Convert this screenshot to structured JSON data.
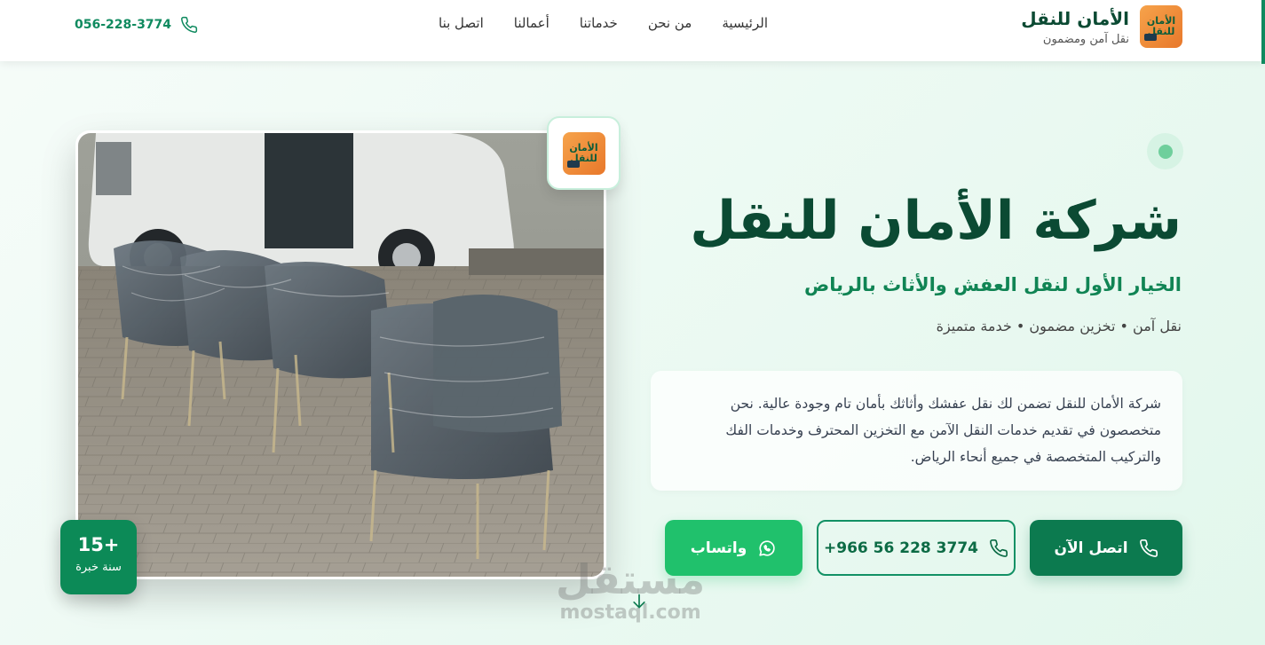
{
  "brand": {
    "name": "الأمان للنقل",
    "tagline": "نقل آمن ومضمون",
    "logo_text_line1": "الأمان",
    "logo_text_line2": "للنقل"
  },
  "nav": {
    "items": [
      "الرئيسية",
      "من نحن",
      "خدماتنا",
      "أعمالنا",
      "اتصل بنا"
    ]
  },
  "header_phone": "056-228-3774",
  "hero": {
    "title": "شركة الأمان للنقل",
    "subtitle": "الخيار الأول لنقل العفش والأثاث بالرياض",
    "features": "نقل آمن • تخزين مضمون • خدمة متميزة",
    "description": "شركة الأمان للنقل تضمن لك نقل عفشك وأثاثك بأمان تام وجودة عالية. نحن متخصصون في تقديم خدمات النقل الآمن مع التخزين المحترف وخدمات الفك والتركيب المتخصصة في جميع أنحاء الرياض."
  },
  "buttons": {
    "call_now": "اتصل الآن",
    "phone": "+966 56 228 3774",
    "whatsapp": "واتساب"
  },
  "experience": {
    "value": "15+",
    "label": "سنة خبرة"
  },
  "watermark": {
    "arabic": "مستقل",
    "latin": "mostaql.com"
  },
  "colors": {
    "primary": "#0c7a4f",
    "whatsapp": "#20c16c",
    "title": "#0b4a33"
  },
  "icons": [
    "phone-icon",
    "whatsapp-icon",
    "arrow-down-icon"
  ]
}
